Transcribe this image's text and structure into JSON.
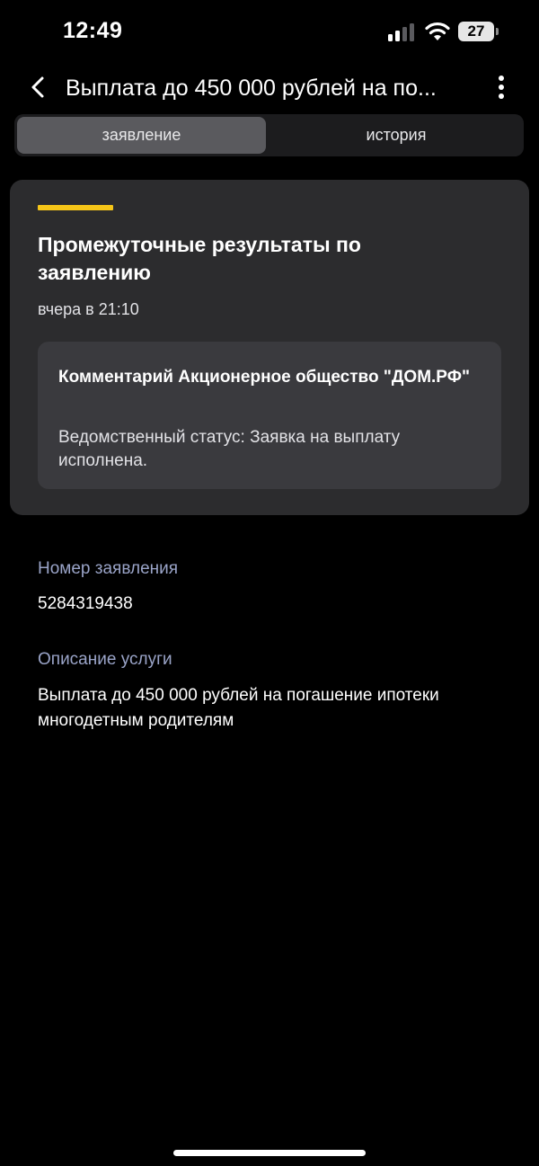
{
  "status_bar": {
    "time": "12:49",
    "battery": "27"
  },
  "header": {
    "title": "Выплата до 450 000 рублей на по..."
  },
  "tabs": [
    {
      "label": "заявление",
      "active": true
    },
    {
      "label": "история",
      "active": false
    }
  ],
  "card": {
    "title": "Промежуточные результаты по заявлению",
    "time": "вчера в 21:10",
    "accent_color": "#f5c518",
    "comment": {
      "title": "Комментарий Акционерное общество \"ДОМ.РФ\"",
      "text": "Ведомственный статус: Заявка на выплату исполнена."
    }
  },
  "details": {
    "number_label": "Номер заявления",
    "number_value": "5284319438",
    "description_label": "Описание услуги",
    "description_value": "Выплата до 450 000 рублей на погашение ипотеки многодетным родителям"
  },
  "colors": {
    "background": "#000000",
    "card": "#2c2c2e",
    "label": "#9aa4c8"
  },
  "icons": {
    "back": "chevron-left-icon",
    "more": "more-vertical-icon",
    "signal": "signal-icon",
    "wifi": "wifi-icon",
    "battery": "battery-icon"
  }
}
